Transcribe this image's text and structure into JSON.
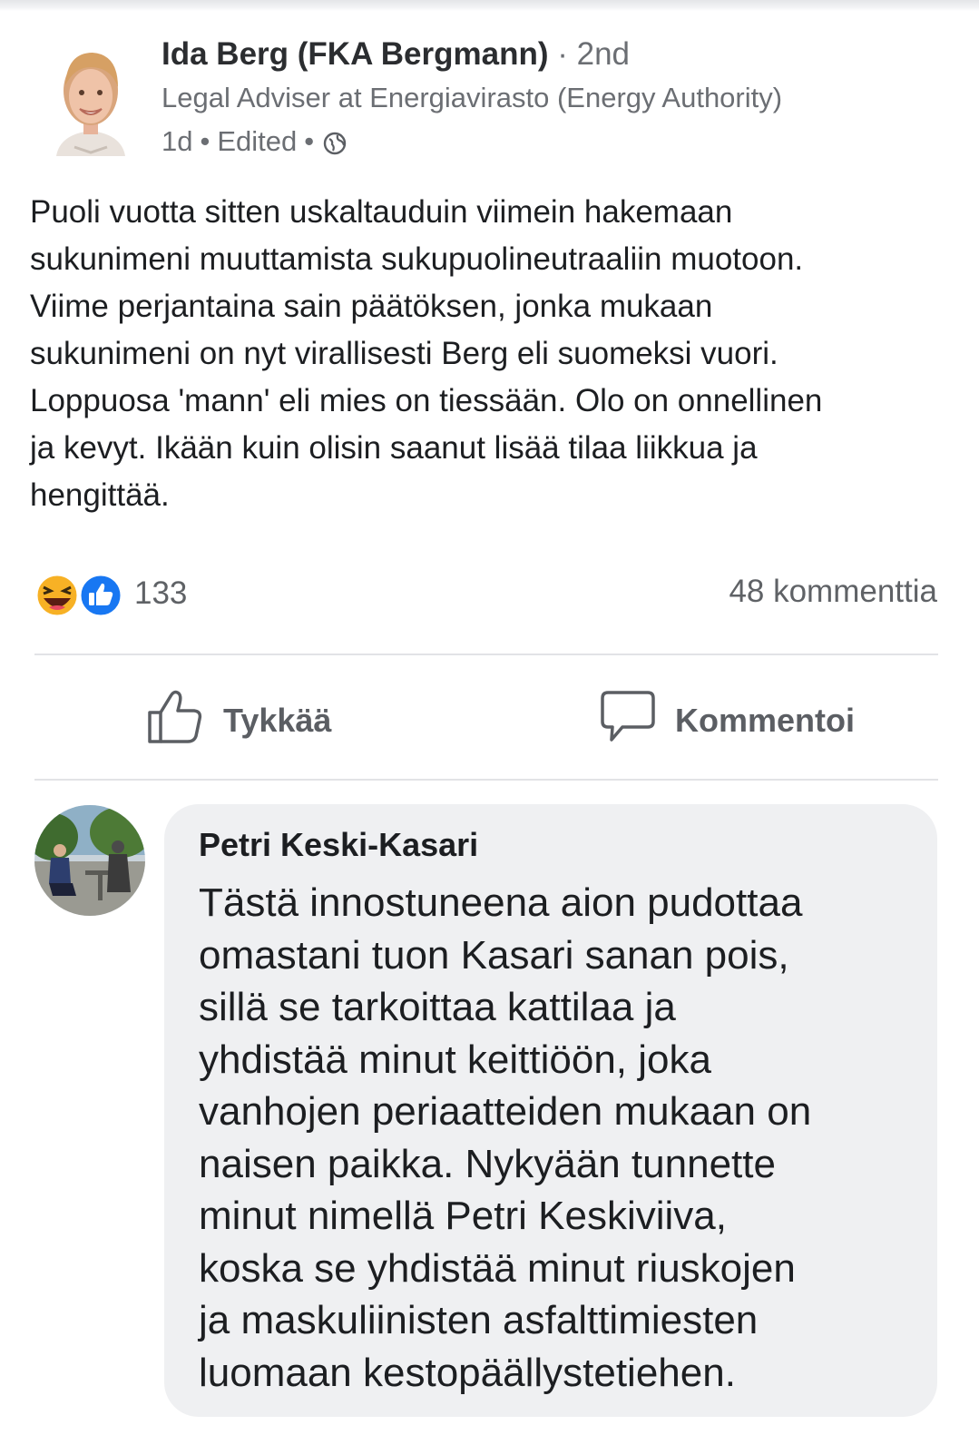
{
  "post": {
    "author_name": "Ida Berg (FKA Bergmann)",
    "connection_degree": " · 2nd",
    "headline": "Legal Adviser at Energiavirasto (Energy Authority)",
    "time": "1d",
    "edited_label": "Edited",
    "visibility_icon": "globe-icon",
    "text": "Puoli vuotta sitten uskaltauduin viimein hakemaan\nsukunimeni muuttamista sukupuolineutraaliin muotoon.\nViime perjantaina sain päätöksen, jonka mukaan\nsukunimeni on nyt virallisesti Berg eli suomeksi vuori.\nLoppuosa 'mann' eli mies on tiessään. Olo on onnellinen\nja kevyt. Ikään kuin olisin saanut lisää tilaa liikkua ja\nhengittää."
  },
  "stats": {
    "reaction_icons": [
      "laughing-emoji-icon",
      "like-thumb-icon"
    ],
    "reaction_count": "133",
    "comment_count": "48 kommenttia"
  },
  "actions": {
    "like_label": "Tykkää",
    "comment_label": "Kommentoi"
  },
  "comment": {
    "author": "Petri Keski-Kasari",
    "text": "Tästä innostuneena aion pudottaa\nomastani tuon Kasari sanan pois,\nsillä se tarkoittaa kattilaa ja\nyhdistää minut keittiöön, joka\nvanhojen periaatteiden mukaan on\nnaisen paikka. Nykyään tunnette\nminut nimellä Petri Keskiviiva,\nkoska se yhdistää minut riuskojen\nja maskuliinisten asfalttimiesten\nluomaan kestopäällystetiehen."
  },
  "colors": {
    "like_blue": "#1877f2",
    "laugh_yellow": "#f7b125",
    "bubble_gray": "#eff0f2",
    "muted_text": "#6b6e73"
  }
}
